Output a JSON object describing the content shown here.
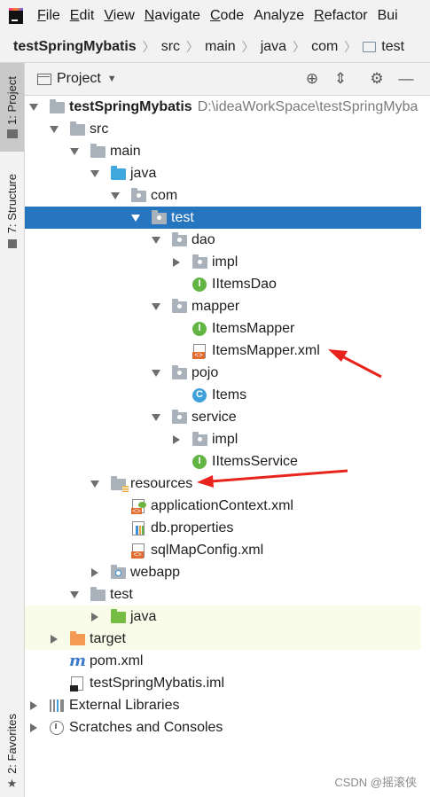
{
  "menubar": {
    "items": [
      {
        "label": "File",
        "mnemonic": "F"
      },
      {
        "label": "Edit",
        "mnemonic": "E"
      },
      {
        "label": "View",
        "mnemonic": "V"
      },
      {
        "label": "Navigate",
        "mnemonic": "N"
      },
      {
        "label": "Code",
        "mnemonic": "C"
      },
      {
        "label": "Analyze",
        "mnemonic": ""
      },
      {
        "label": "Refactor",
        "mnemonic": "R"
      },
      {
        "label": "Bui",
        "mnemonic": ""
      }
    ]
  },
  "breadcrumb": [
    "testSpringMybatis",
    "src",
    "main",
    "java",
    "com",
    "test"
  ],
  "left_strip": {
    "project_tab": "1: Project",
    "structure_tab": "7: Structure",
    "favorites_tab": "2: Favorites"
  },
  "panel": {
    "title": "Project",
    "icons": [
      "locate-icon",
      "collapse-all-icon",
      "gear-icon",
      "minimize-icon"
    ]
  },
  "tree": [
    {
      "level": 0,
      "expand": "down",
      "icon": "module-folder-icon",
      "label": "testSpringMybatis",
      "bold": true,
      "path": "D:\\ideaWorkSpace\\testSpringMyba"
    },
    {
      "level": 1,
      "expand": "down",
      "icon": "folder-icon",
      "label": "src"
    },
    {
      "level": 2,
      "expand": "down",
      "icon": "folder-icon",
      "label": "main"
    },
    {
      "level": 3,
      "expand": "down",
      "icon": "source-folder-icon",
      "label": "java"
    },
    {
      "level": 4,
      "expand": "down",
      "icon": "package-icon",
      "label": "com"
    },
    {
      "level": 5,
      "expand": "down",
      "icon": "package-icon",
      "label": "test",
      "selected": true
    },
    {
      "level": 6,
      "expand": "down",
      "icon": "package-icon",
      "label": "dao"
    },
    {
      "level": 7,
      "expand": "right",
      "icon": "package-icon",
      "label": "impl"
    },
    {
      "level": 7,
      "expand": "none",
      "icon": "interface-icon",
      "label": "IItemsDao"
    },
    {
      "level": 6,
      "expand": "down",
      "icon": "package-icon",
      "label": "mapper"
    },
    {
      "level": 7,
      "expand": "none",
      "icon": "interface-icon",
      "label": "ItemsMapper"
    },
    {
      "level": 7,
      "expand": "none",
      "icon": "xml-file-icon",
      "label": "ItemsMapper.xml"
    },
    {
      "level": 6,
      "expand": "down",
      "icon": "package-icon",
      "label": "pojo"
    },
    {
      "level": 7,
      "expand": "none",
      "icon": "class-icon",
      "label": "Items"
    },
    {
      "level": 6,
      "expand": "down",
      "icon": "package-icon",
      "label": "service"
    },
    {
      "level": 7,
      "expand": "right",
      "icon": "package-icon",
      "label": "impl"
    },
    {
      "level": 7,
      "expand": "none",
      "icon": "interface-icon",
      "label": "IItemsService"
    },
    {
      "level": 3,
      "expand": "down",
      "icon": "resources-folder-icon",
      "label": "resources"
    },
    {
      "level": 4,
      "expand": "none",
      "icon": "spring-xml-icon",
      "label": "applicationContext.xml"
    },
    {
      "level": 4,
      "expand": "none",
      "icon": "properties-file-icon",
      "label": "db.properties"
    },
    {
      "level": 4,
      "expand": "none",
      "icon": "xml-file-icon",
      "label": "sqlMapConfig.xml"
    },
    {
      "level": 3,
      "expand": "right",
      "icon": "web-folder-icon",
      "label": "webapp"
    },
    {
      "level": 2,
      "expand": "down",
      "icon": "folder-icon",
      "label": "test"
    },
    {
      "level": 3,
      "expand": "right",
      "icon": "test-folder-icon",
      "label": "java",
      "highlight": true
    },
    {
      "level": 1,
      "expand": "right",
      "icon": "excluded-folder-icon",
      "label": "target",
      "highlight": true
    },
    {
      "level": 1,
      "expand": "none",
      "icon": "maven-pom-icon",
      "label": "pom.xml"
    },
    {
      "level": 1,
      "expand": "none",
      "icon": "iml-file-icon",
      "label": "testSpringMybatis.iml"
    },
    {
      "level": 0,
      "expand": "right",
      "icon": "libraries-icon",
      "label": "External Libraries"
    },
    {
      "level": 0,
      "expand": "right",
      "icon": "scratches-icon",
      "label": "Scratches and Consoles"
    }
  ],
  "watermark": "CSDN @摇滚侠",
  "colors": {
    "selection": "#2675bf",
    "annotation_arrow": "#e8241c",
    "highlight_row": "#f9fce8"
  }
}
